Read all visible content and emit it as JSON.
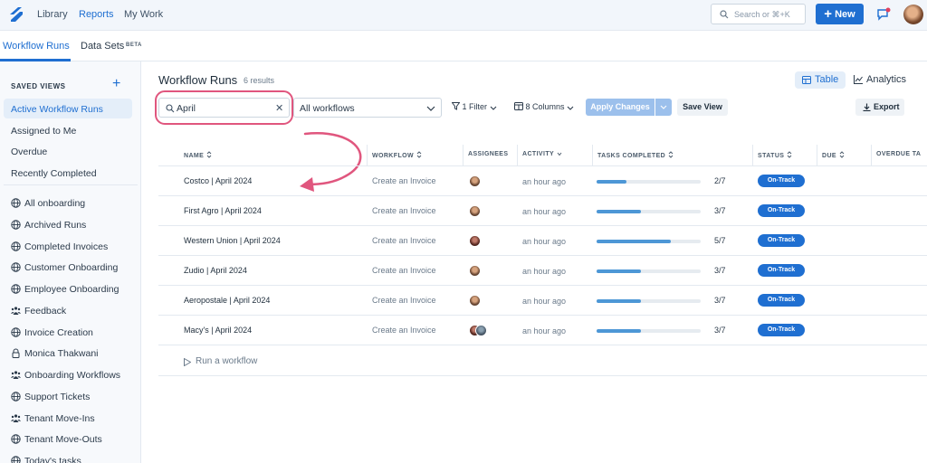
{
  "topnav": {
    "items": [
      "Library",
      "Reports",
      "My Work"
    ],
    "active": "Reports",
    "search_placeholder": "Search or ⌘+K",
    "new_label": "New"
  },
  "subtabs": {
    "items": [
      "Workflow Runs",
      "Data Sets"
    ],
    "active": "Workflow Runs",
    "beta": "BETA"
  },
  "sidebar": {
    "saved_views_heading": "SAVED VIEWS",
    "saved_views": [
      "Active Workflow Runs",
      "Assigned to Me",
      "Overdue",
      "Recently Completed"
    ],
    "active": "Active Workflow Runs",
    "items": [
      {
        "label": "All onboarding",
        "icon": "globe-icon"
      },
      {
        "label": "Archived Runs",
        "icon": "globe-icon"
      },
      {
        "label": "Completed Invoices",
        "icon": "globe-icon"
      },
      {
        "label": "Customer Onboarding",
        "icon": "globe-icon"
      },
      {
        "label": "Employee Onboarding",
        "icon": "globe-icon"
      },
      {
        "label": "Feedback",
        "icon": "group-icon"
      },
      {
        "label": "Invoice Creation",
        "icon": "globe-icon"
      },
      {
        "label": "Monica Thakwani",
        "icon": "lock-icon"
      },
      {
        "label": "Onboarding Workflows",
        "icon": "group-icon"
      },
      {
        "label": "Support Tickets",
        "icon": "globe-icon"
      },
      {
        "label": "Tenant Move-Ins",
        "icon": "group-icon"
      },
      {
        "label": "Tenant Move-Outs",
        "icon": "globe-icon"
      },
      {
        "label": "Today's tasks",
        "icon": "globe-icon"
      }
    ]
  },
  "main": {
    "title": "Workflow Runs",
    "results": "6 results",
    "view_table": "Table",
    "view_analytics": "Analytics",
    "search_value": "April",
    "workflow_select": "All workflows",
    "filter_label": "1 Filter",
    "columns_label": "8 Columns",
    "apply_label": "Apply Changes",
    "save_view_label": "Save View",
    "export_label": "Export",
    "run_workflow_label": "Run a workflow"
  },
  "table": {
    "headers": [
      "NAME",
      "WORKFLOW",
      "ASSIGNEES",
      "ACTIVITY",
      "TASKS COMPLETED",
      "STATUS",
      "DUE",
      "OVERDUE TA"
    ],
    "rows": [
      {
        "name": "Costco | April 2024",
        "workflow": "Create an Invoice",
        "activity": "an hour ago",
        "tasks": "2/7",
        "done": 2,
        "total": 7,
        "status": "On-Track",
        "assignees": [
          "a"
        ]
      },
      {
        "name": "First Agro | April 2024",
        "workflow": "Create an Invoice",
        "activity": "an hour ago",
        "tasks": "3/7",
        "done": 3,
        "total": 7,
        "status": "On-Track",
        "assignees": [
          "a"
        ]
      },
      {
        "name": "Western Union | April 2024",
        "workflow": "Create an Invoice",
        "activity": "an hour ago",
        "tasks": "5/7",
        "done": 5,
        "total": 7,
        "status": "On-Track",
        "assignees": [
          "b"
        ]
      },
      {
        "name": "Zudio | April 2024",
        "workflow": "Create an Invoice",
        "activity": "an hour ago",
        "tasks": "3/7",
        "done": 3,
        "total": 7,
        "status": "On-Track",
        "assignees": [
          "a"
        ]
      },
      {
        "name": "Aeropostale | April 2024",
        "workflow": "Create an Invoice",
        "activity": "an hour ago",
        "tasks": "3/7",
        "done": 3,
        "total": 7,
        "status": "On-Track",
        "assignees": [
          "a"
        ]
      },
      {
        "name": "Macy's | April 2024",
        "workflow": "Create an Invoice",
        "activity": "an hour ago",
        "tasks": "3/7",
        "done": 3,
        "total": 7,
        "status": "On-Track",
        "assignees": [
          "b",
          "c"
        ]
      }
    ]
  },
  "colors": {
    "accent": "#1f6fd1",
    "highlight": "#e0567e",
    "progress": "#4d97d6"
  }
}
